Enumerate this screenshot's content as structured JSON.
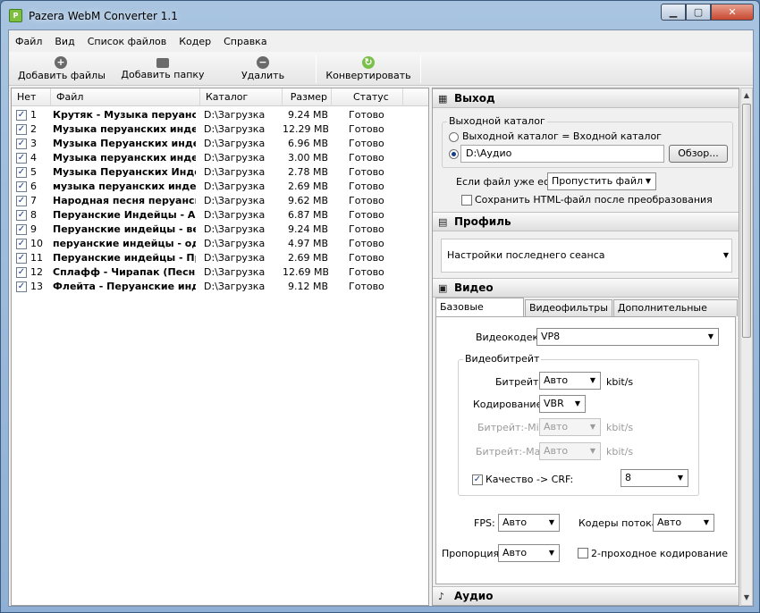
{
  "window": {
    "title": "Pazera WebM Converter 1.1",
    "icon_letter": "P"
  },
  "menu": [
    "Файл",
    "Вид",
    "Список файлов",
    "Кодер",
    "Справка"
  ],
  "toolbar": {
    "add_files": "Добавить файлы",
    "add_folder": "Добавить папку",
    "remove": "Удалить",
    "convert": "Конвертировать"
  },
  "filelist": {
    "columns": [
      "Нет",
      "Файл",
      "Каталог",
      "Размер",
      "Статус"
    ],
    "rows": [
      {
        "n": "1",
        "file": "Крутяк - Музыка перуанс...",
        "dir": "D:\\Загрузка",
        "size": "9.24 MB",
        "status": "Готово"
      },
      {
        "n": "2",
        "file": "Музыка перуанских инде...",
        "dir": "D:\\Загрузка",
        "size": "12.29 MB",
        "status": "Готово"
      },
      {
        "n": "3",
        "file": "Музыка Перуанских инде...",
        "dir": "D:\\Загрузка",
        "size": "6.96 MB",
        "status": "Готово"
      },
      {
        "n": "4",
        "file": "Музыка перуанских индей...",
        "dir": "D:\\Загрузка",
        "size": "3.00 MB",
        "status": "Готово"
      },
      {
        "n": "5",
        "file": "Музыка Перуанских Инде...",
        "dir": "D:\\Загрузка",
        "size": "2.78 MB",
        "status": "Готово"
      },
      {
        "n": "6",
        "file": "музыка перуанских индей...",
        "dir": "D:\\Загрузка",
        "size": "2.69 MB",
        "status": "Готово"
      },
      {
        "n": "7",
        "file": "Народная песня перуанск...",
        "dir": "D:\\Загрузка",
        "size": "9.62 MB",
        "status": "Готово"
      },
      {
        "n": "8",
        "file": "Перуанские Индейцы - Au...",
        "dir": "D:\\Загрузка",
        "size": "6.87 MB",
        "status": "Готово"
      },
      {
        "n": "9",
        "file": "Перуанские индейцы - ве...",
        "dir": "D:\\Загрузка",
        "size": "9.24 MB",
        "status": "Готово"
      },
      {
        "n": "10",
        "file": "перуанские индейцы - од...",
        "dir": "D:\\Загрузка",
        "size": "4.97 MB",
        "status": "Готово"
      },
      {
        "n": "11",
        "file": "Перуанские индейцы - Пр...",
        "dir": "D:\\Загрузка",
        "size": "2.69 MB",
        "status": "Готово"
      },
      {
        "n": "12",
        "file": "Сплафф - Чирапак (Песня пе...",
        "dir": "D:\\Загрузка",
        "size": "12.69 MB",
        "status": "Готово"
      },
      {
        "n": "13",
        "file": "Флейта - Перуанские инде...",
        "dir": "D:\\Загрузка",
        "size": "9.12 MB",
        "status": "Готово"
      }
    ]
  },
  "output": {
    "section_title": "Выход",
    "group_label": "Выходной каталог",
    "radio_same": "Выходной каталог = Входной каталог",
    "dir_value": "D:\\Аудио",
    "browse": "Обзор...",
    "if_exists_label": "Если файл уже есть",
    "if_exists_value": "Пропустить файл",
    "save_html": "Сохранить HTML-файл после преобразования"
  },
  "profile": {
    "section_title": "Профиль",
    "value": "Настройки последнего сеанса"
  },
  "video": {
    "section_title": "Видео",
    "tabs": [
      "Базовые настройки",
      "Видеофильтры",
      "Дополнительные настройки"
    ],
    "codec_label": "Видеокодек:",
    "codec_value": "VP8",
    "bitrate_group": "Видеобитрейт",
    "bitrate_label": "Битрейт:",
    "bitrate_value": "Авто",
    "kbits": "kbit/s",
    "encoding_label": "Кодирование:",
    "encoding_value": "VBR",
    "min_label": "Битрейт:-Min",
    "min_value": "Авто",
    "max_label": "Битрейт:-Max",
    "max_value": "Авто",
    "crf_label": "Качество -> CRF:",
    "crf_value": "8",
    "fps_label": "FPS:",
    "fps_value": "Авто",
    "threads_label": "Кодеры потока:",
    "threads_value": "Авто",
    "aspect_label": "Пропорция:",
    "aspect_value": "Авто",
    "twopass": "2-проходное кодирование"
  },
  "audio": {
    "section_title": "Аудио"
  }
}
